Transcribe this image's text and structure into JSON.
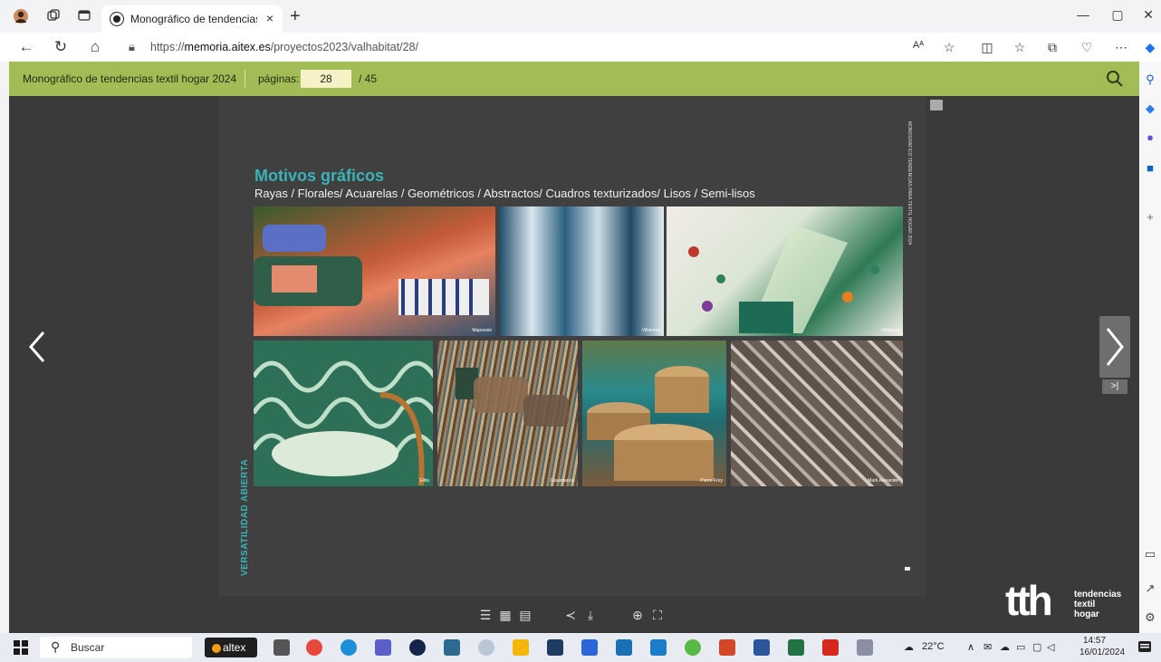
{
  "browser": {
    "tab_title": "Monográfico de tendencias textil",
    "tab_close": "×",
    "new_tab": "+",
    "url_prefix": "https://",
    "url_host": "memoria.aitex.es",
    "url_path": "/proyectos2023/valhabitat/28/",
    "read_aloud": "Aᴬ"
  },
  "viewer": {
    "doc_title": "Monográfico de tendencias textil hogar 2024",
    "pages_label": "páginas:",
    "current_page": "28",
    "total_pages": "/ 45",
    "last_page_button": ">|"
  },
  "page": {
    "heading": "Motivos gráficos",
    "subtitle": "Rayas / Florales/ Acuarelas / Geométricos / Abstractos/ Cuadros texturizados/ Lisos / Semi-lisos",
    "side_label": "VERSATILIDAD ABIERTA",
    "small_vertical": "MONOGRÁFICO TENDENCIAS PARA TEXTIL HOGAR 2024",
    "photos": [
      {
        "caption": "Mapoesie"
      },
      {
        "caption": "Villanova"
      },
      {
        "caption": "Villanova"
      },
      {
        "caption": "Élitis"
      },
      {
        "caption": "Casamance"
      },
      {
        "caption": "Pierre Frey"
      },
      {
        "caption": "Mark Alexander"
      }
    ]
  },
  "logo": {
    "big": "tth",
    "line1": "tendencias",
    "line2": "textil",
    "line3": "hogar"
  },
  "taskbar": {
    "search_label": "Buscar",
    "app_label": "altex",
    "weather": "22°C",
    "time": "14:57",
    "date": "16/01/2024"
  }
}
